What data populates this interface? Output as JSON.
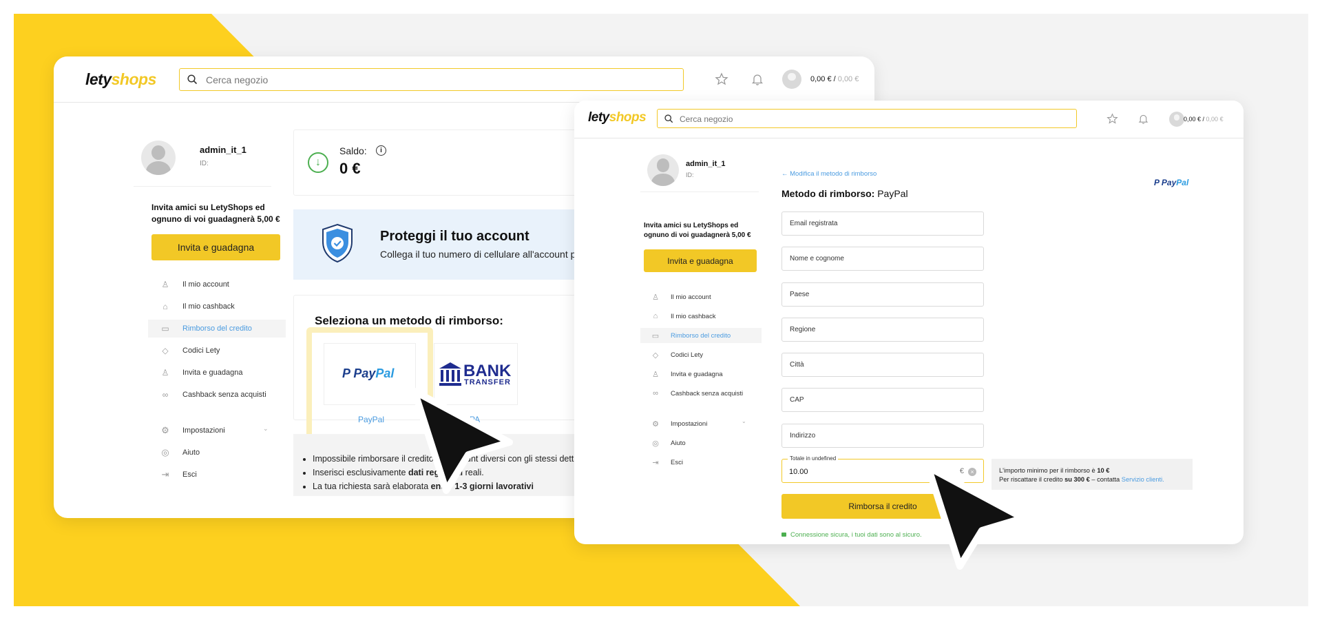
{
  "colors": {
    "accent_yellow": "#f2c826",
    "link_blue": "#4a9be0",
    "success_green": "#4caf50",
    "paypal_dark": "#1b3e8c",
    "bank_navy": "#1f2c8f"
  },
  "brand": {
    "logo_part1": "lety",
    "logo_part2": "shops"
  },
  "header": {
    "search_placeholder": "Cerca negozio",
    "balance_main": "0,00 €",
    "balance_sep": " / ",
    "balance_pending": "0,00 €"
  },
  "profile": {
    "username": "admin_it_1",
    "id_label": "ID:"
  },
  "invite": {
    "line1": "Invita amici su LetyShops ed",
    "line2": "ognuno di voi guadagnerà 5,00 €",
    "button": "Invita e guadagna"
  },
  "nav": [
    {
      "label": "Il mio account",
      "icon": "user-icon"
    },
    {
      "label": "Il mio cashback",
      "icon": "bag-icon"
    },
    {
      "label": "Rimborso del credito",
      "icon": "wallet-icon"
    },
    {
      "label": "Codici Lety",
      "icon": "tag-icon"
    },
    {
      "label": "Invita e guadagna",
      "icon": "add-user-icon"
    },
    {
      "label": "Cashback senza acquisti",
      "icon": "link-icon"
    }
  ],
  "nav_secondary": [
    {
      "label": "Impostazioni",
      "icon": "gear-icon"
    },
    {
      "label": "Aiuto",
      "icon": "help-icon"
    },
    {
      "label": "Esci",
      "icon": "logout-icon"
    }
  ],
  "saldo": {
    "label": "Saldo:",
    "value": "0 €"
  },
  "protect": {
    "title": "Proteggi il tuo account",
    "subtitle": "Collega il tuo numero di cellulare all'account pe"
  },
  "method": {
    "title": "Seleziona un metodo di rimborso:",
    "paypal_logo1": "Pay",
    "paypal_logo2": "Pal",
    "paypal_label": "PayPal",
    "bank_line1": "BANK",
    "bank_line2": "TRANSFER",
    "bank_label_partial": "PA"
  },
  "notes": {
    "n1": "Impossibile rimborsare il credito da account diversi con gli stessi dettag",
    "n2_pre": "Inserisci esclusivamente ",
    "n2_bold": "dati registrati",
    "n2_post": " reali.",
    "n3_pre": "La tua richiesta sarà elaborata ",
    "n3_bold": "entro 1-3 giorni lavorativi"
  },
  "form": {
    "back_link": "← Modifica il metodo di rimborso",
    "title_bold": "Metodo di rimborso:",
    "title_value": " PayPal",
    "fields": [
      "Email registrata",
      "Nome e cognome",
      "Paese",
      "Regione",
      "Città",
      "CAP",
      "Indirizzo"
    ],
    "amount_label": "Totale in undefined",
    "amount_value": "10.00",
    "currency": "€",
    "submit": "Rimborsa il credito",
    "secure": "Connessione sicura, i tuoi dati sono al sicuro."
  },
  "min_info": {
    "l1_pre": "L'importo minimo per il rimborso è ",
    "l1_bold": "10 €",
    "l2_pre": "Per riscattare il credito ",
    "l2_bold": "su 300 €",
    "l2_mid": " – contatta ",
    "l2_link": "Servizio clienti."
  }
}
